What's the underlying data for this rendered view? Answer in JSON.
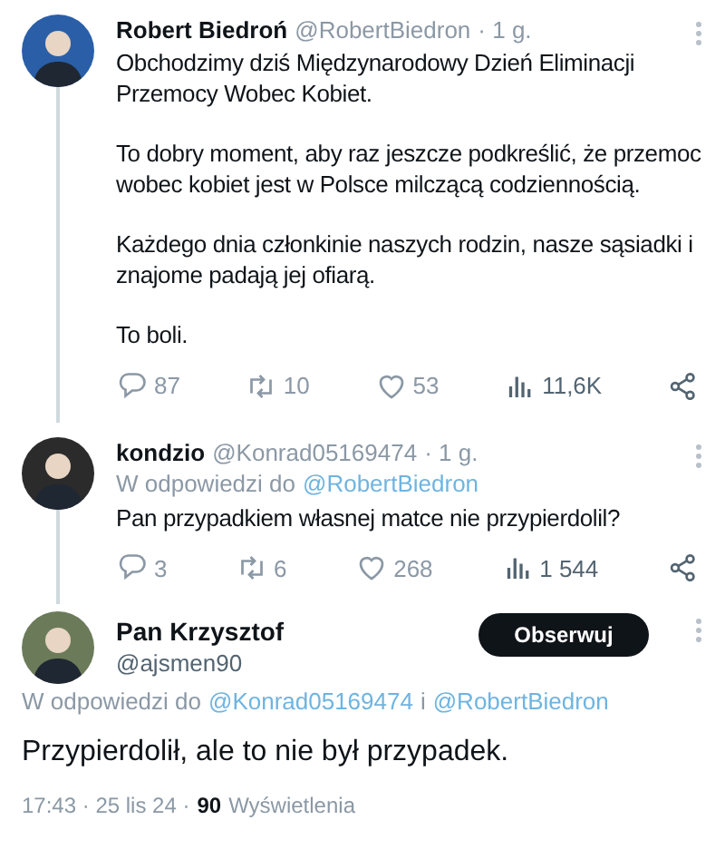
{
  "tweets": [
    {
      "kind": "thread",
      "name": "Robert Biedroń",
      "handle": "@RobertBiedron",
      "time": "· 1 g.",
      "paragraphs": [
        "Obchodzimy dziś Międzynarodowy Dzień Eliminacji Przemocy Wobec Kobiet.",
        "To dobry moment, aby raz jeszcze podkreślić, że przemoc wobec kobiet jest w Polsce milczącą codziennością.",
        "Każdego dnia członkinie naszych rodzin, nasze sąsiadki i znajome padają jej ofiarą.",
        "To boli."
      ],
      "stats": [
        {
          "kind": "reply",
          "count": "87"
        },
        {
          "kind": "retweet",
          "count": "10"
        },
        {
          "kind": "like",
          "count": "53"
        },
        {
          "kind": "views",
          "count": "11,6K"
        },
        {
          "kind": "share"
        }
      ]
    },
    {
      "kind": "thread",
      "name": "kondzio",
      "handle": "@Konrad05169474",
      "time": "· 1 g.",
      "reply": {
        "prefix": "W odpowiedzi do",
        "mentions": [
          "@RobertBiedron"
        ]
      },
      "paragraphs": [
        "Pan przypadkiem własnej matce nie przypierdolil?"
      ],
      "stats": [
        {
          "kind": "reply",
          "count": "3"
        },
        {
          "kind": "retweet",
          "count": "6"
        },
        {
          "kind": "like",
          "count": "268"
        },
        {
          "kind": "views",
          "count": "1 544"
        },
        {
          "kind": "share"
        }
      ]
    },
    {
      "kind": "focused",
      "name": "Pan Krzysztof",
      "handle": "@ajsmen90",
      "follow": "Obserwuj",
      "reply": {
        "prefix": "W odpowiedzi do",
        "mentions": [
          "@Konrad05169474",
          "@RobertBiedron"
        ],
        "joiner": "i"
      },
      "paragraphs": [
        "Przypierdolił, ale to nie był przypadek."
      ],
      "footer": {
        "time": "17:43 · 25 lis 24 ·",
        "views": "90",
        "views_label": "Wyświetlenia"
      }
    }
  ]
}
